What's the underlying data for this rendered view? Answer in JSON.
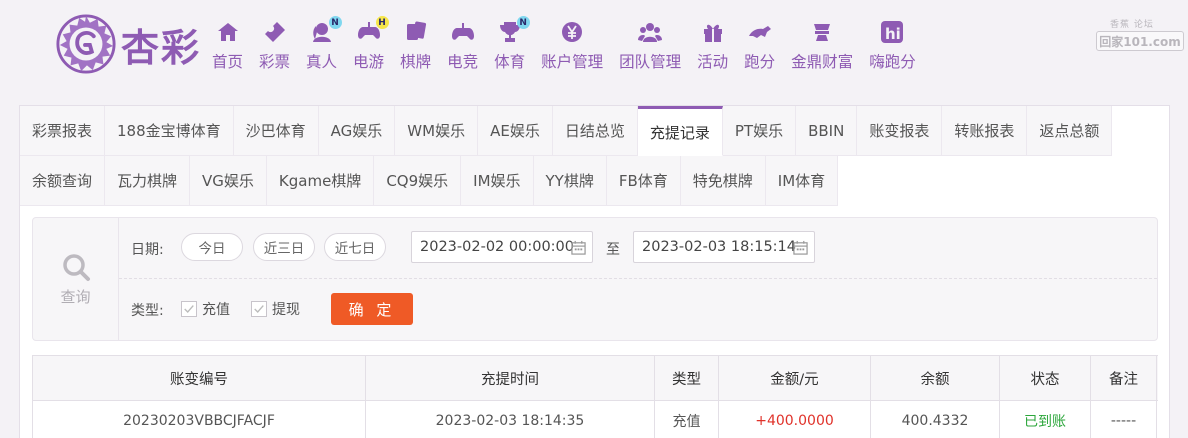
{
  "brand": {
    "name": "杏彩"
  },
  "nav": [
    {
      "label": "首页",
      "icon": "home-icon",
      "badge": ""
    },
    {
      "label": "彩票",
      "icon": "ticket-icon",
      "badge": ""
    },
    {
      "label": "真人",
      "icon": "live-dealer-icon",
      "badge": "N"
    },
    {
      "label": "电游",
      "icon": "gamepad-icon",
      "badge": "H"
    },
    {
      "label": "棋牌",
      "icon": "cards-icon",
      "badge": ""
    },
    {
      "label": "电竞",
      "icon": "esports-controller-icon",
      "badge": ""
    },
    {
      "label": "体育",
      "icon": "trophy-icon",
      "badge": "N"
    },
    {
      "label": "账户管理",
      "icon": "yen-coin-icon",
      "badge": ""
    },
    {
      "label": "团队管理",
      "icon": "team-icon",
      "badge": ""
    },
    {
      "label": "活动",
      "icon": "gift-icon",
      "badge": ""
    },
    {
      "label": "跑分",
      "icon": "running-icon",
      "badge": ""
    },
    {
      "label": "金鼎财富",
      "icon": "wealth-icon",
      "badge": ""
    },
    {
      "label": "嗨跑分",
      "icon": "hi-icon",
      "badge": ""
    }
  ],
  "badge_colors": {
    "N": "#7fd7ef",
    "H": "#f6e64a"
  },
  "watermark": {
    "top": "香蕉  论坛",
    "box": "回家101.com"
  },
  "tabs_row1": [
    "彩票报表",
    "188金宝博体育",
    "沙巴体育",
    "AG娱乐",
    "WM娱乐",
    "AE娱乐",
    "日结总览",
    "充提记录",
    "PT娱乐",
    "BBIN",
    "账变报表",
    "转账报表",
    "返点总额"
  ],
  "tabs_row2": [
    "余额查询",
    "瓦力棋牌",
    "VG娱乐",
    "Kgame棋牌",
    "CQ9娱乐",
    "IM娱乐",
    "YY棋牌",
    "FB体育",
    "特免棋牌",
    "IM体育"
  ],
  "active_tab": "充提记录",
  "filter": {
    "query_label": "查询",
    "date_label": "日期:",
    "quick": [
      "今日",
      "近三日",
      "近七日"
    ],
    "start": "2023-02-02 00:00:00",
    "to": "至",
    "end": "2023-02-03 18:15:14",
    "type_label": "类型:",
    "types": [
      "充值",
      "提现"
    ],
    "confirm": "确 定"
  },
  "table": {
    "headers": [
      "账变编号",
      "充提时间",
      "类型",
      "金额/元",
      "余额",
      "状态",
      "备注"
    ],
    "rows": [
      [
        "20230203VBBCJFACJF",
        "2023-02-03 18:14:35",
        "充值",
        "+400.0000",
        "400.4332",
        "已到账",
        "-----"
      ]
    ]
  },
  "colors": {
    "brand": "#8e5bb3",
    "confirm": "#ef5a26",
    "amount": "#e0322a",
    "status_ok": "#2ca63b"
  }
}
